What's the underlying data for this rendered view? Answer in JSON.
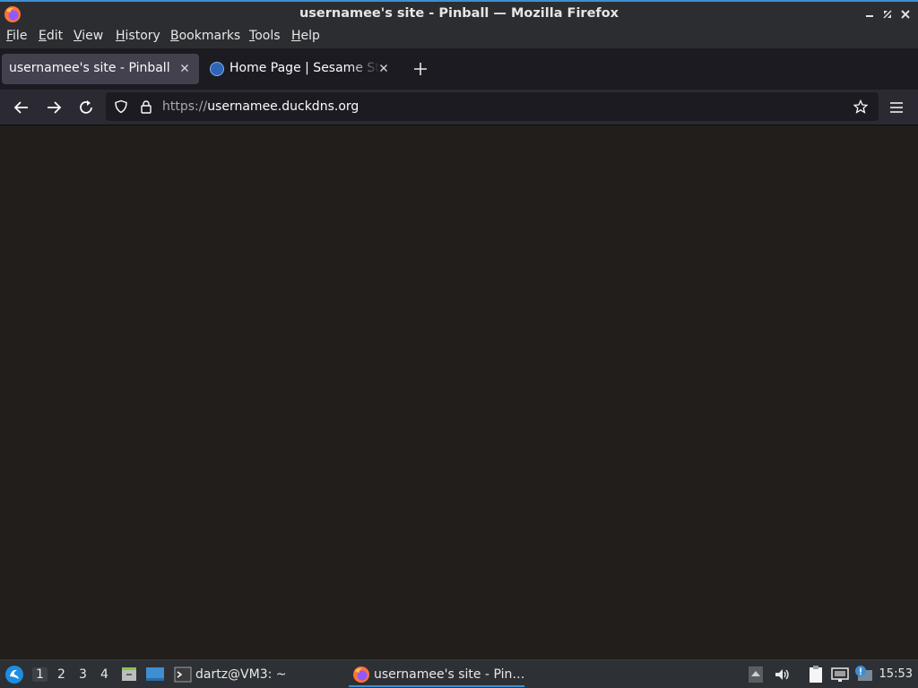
{
  "window": {
    "title": "usernamee's site - Pinball — Mozilla Firefox"
  },
  "menu": {
    "items": [
      {
        "label": "File",
        "mnemonic": "F",
        "rest": "ile"
      },
      {
        "label": "Edit",
        "mnemonic": "E",
        "rest": "dit"
      },
      {
        "label": "View",
        "mnemonic": "V",
        "rest": "iew"
      },
      {
        "label": "History",
        "mnemonic": "H",
        "rest": "istory"
      },
      {
        "label": "Bookmarks",
        "mnemonic": "B",
        "rest": "ookmarks"
      },
      {
        "label": "Tools",
        "mnemonic": "T",
        "rest": "ools"
      },
      {
        "label": "Help",
        "mnemonic": "H",
        "rest": "elp"
      }
    ]
  },
  "tabs": [
    {
      "label": "usernamee's site - Pinball",
      "active": true
    },
    {
      "label": "Home Page | Sesame Street",
      "active": false
    }
  ],
  "navbar": {
    "url_scheme": "https://",
    "url_host": "usernamee.duckdns.org"
  },
  "taskbar": {
    "workspaces": [
      "1",
      "2",
      "3",
      "4"
    ],
    "active_workspace": "1",
    "terminal_task": "dartz@VM3: ~",
    "firefox_task": "usernamee's site - Pin…",
    "clock": "15:53"
  },
  "colors": {
    "accent": "#3d8fd1",
    "page_background": "#211e1b",
    "toolbar": "#2b2a33",
    "tabstrip": "#1c1b22"
  }
}
